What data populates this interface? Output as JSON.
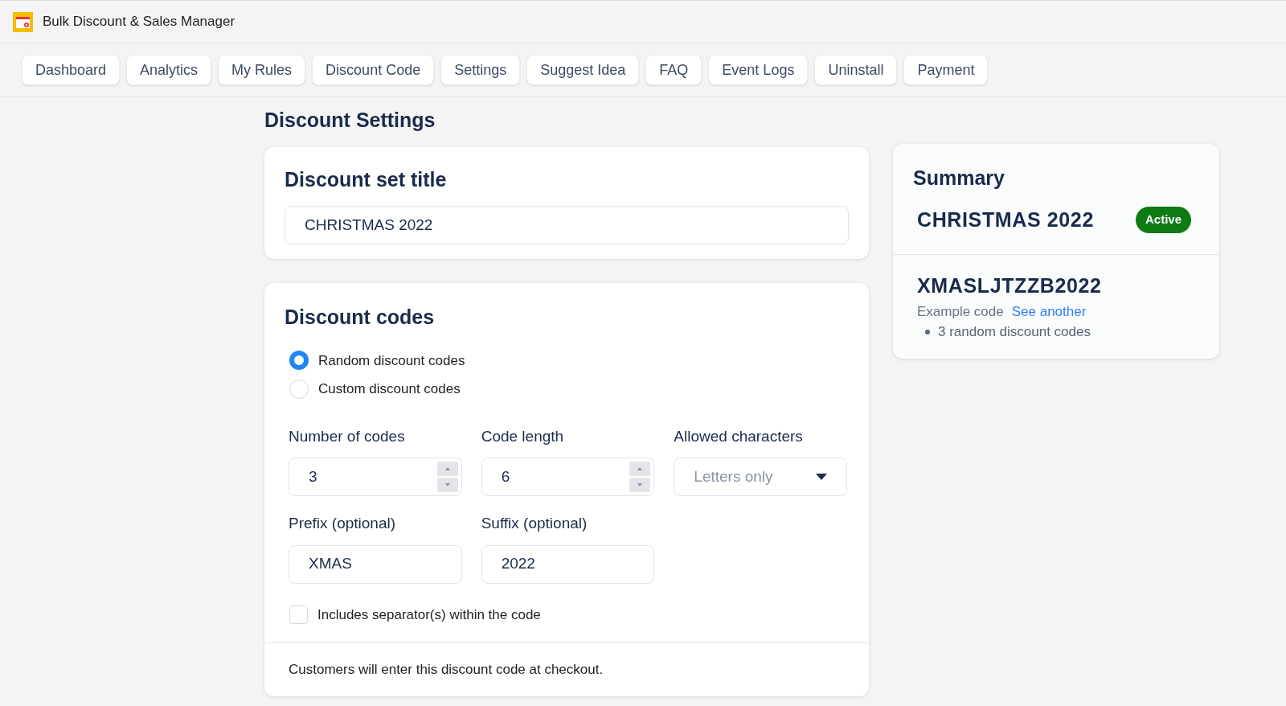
{
  "app": {
    "title": "Bulk Discount & Sales Manager"
  },
  "nav": [
    {
      "label": "Dashboard"
    },
    {
      "label": "Analytics"
    },
    {
      "label": "My Rules"
    },
    {
      "label": "Discount Code"
    },
    {
      "label": "Settings"
    },
    {
      "label": "Suggest Idea"
    },
    {
      "label": "FAQ"
    },
    {
      "label": "Event Logs"
    },
    {
      "label": "Uninstall"
    },
    {
      "label": "Payment"
    }
  ],
  "page_title": "Discount Settings",
  "title_card": {
    "heading": "Discount set title",
    "value": "CHRISTMAS 2022"
  },
  "codes_card": {
    "heading": "Discount codes",
    "options": [
      {
        "label": "Random discount codes",
        "selected": true
      },
      {
        "label": "Custom discount codes",
        "selected": false
      }
    ],
    "fields": [
      {
        "kind": "number",
        "label": "Number of codes",
        "value": "3"
      },
      {
        "kind": "number",
        "label": "Code length",
        "value": "6"
      },
      {
        "kind": "select",
        "label": "Allowed characters",
        "placeholder": "Letters only"
      },
      {
        "kind": "text",
        "label": "Prefix (optional)",
        "value": "XMAS"
      },
      {
        "kind": "text",
        "label": "Suffix (optional)",
        "value": "2022"
      }
    ],
    "separator": {
      "label": "Includes separator(s) within the code",
      "checked": false
    },
    "footer": "Customers will enter this discount code at checkout."
  },
  "summary": {
    "heading": "Summary",
    "title": "CHRISTMAS 2022",
    "status": "Active",
    "example_code": "XMASLJTZZB2022",
    "example_label": "Example code",
    "example_link": "See another",
    "bullets": [
      "3 random discount codes"
    ]
  }
}
